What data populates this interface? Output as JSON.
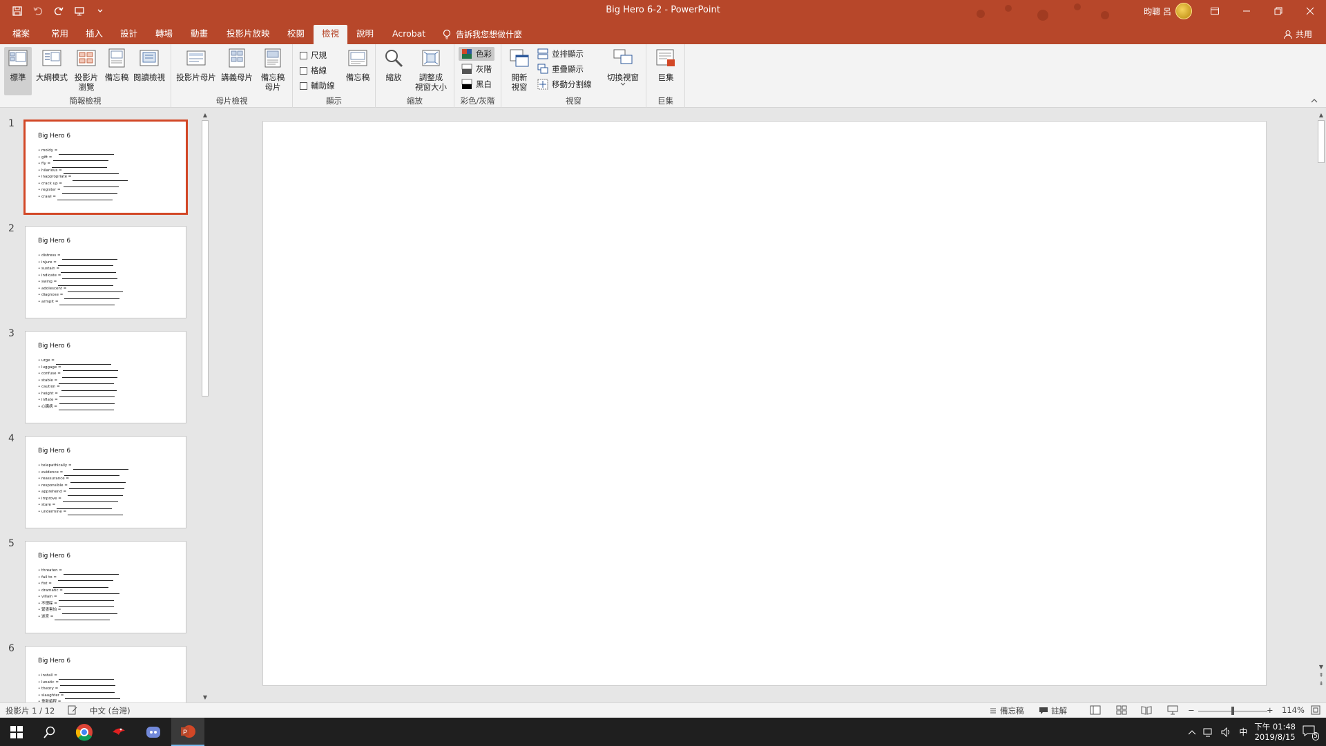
{
  "window": {
    "title": "Big Hero 6-2  -  PowerPoint",
    "user": "昀聰 呂"
  },
  "tabs": [
    "檔案",
    "常用",
    "插入",
    "設計",
    "轉場",
    "動畫",
    "投影片放映",
    "校閱",
    "檢視",
    "說明",
    "Acrobat"
  ],
  "active_tab": "檢視",
  "tell_me": "告訴我您想做什麼",
  "share": "共用",
  "ribbon": {
    "presentation_views": {
      "label": "簡報檢視",
      "normal": "標準",
      "outline": "大綱模式",
      "sorter_1": "投影片",
      "sorter_2": "瀏覽",
      "notes_page": "備忘稿",
      "reading": "閱讀檢視"
    },
    "master_views": {
      "label": "母片檢視",
      "slide_master": "投影片母片",
      "handout_master": "講義母片",
      "notes_master_1": "備忘稿",
      "notes_master_2": "母片"
    },
    "show": {
      "label": "顯示",
      "ruler": "尺規",
      "gridlines": "格線",
      "guides": "輔助線",
      "notes": "備忘稿"
    },
    "zoom": {
      "label": "縮放",
      "zoom": "縮放",
      "fit_1": "調整成",
      "fit_2": "視窗大小"
    },
    "color": {
      "label": "彩色/灰階",
      "color": "色彩",
      "grayscale": "灰階",
      "bw": "黑白"
    },
    "window": {
      "label": "視窗",
      "new_1": "開新",
      "new_2": "視窗",
      "arrange": "並排顯示",
      "cascade": "重疊顯示",
      "move_split": "移動分割線",
      "switch": "切換視窗"
    },
    "macros": {
      "label": "巨集",
      "macros": "巨集"
    }
  },
  "slides": [
    {
      "num": "1",
      "title": "Big Hero 6",
      "items": [
        "moldy =",
        "gift =",
        "fly =",
        "hilarious =",
        "inappropriate =",
        "crack up =",
        "register =",
        "crawl ="
      ]
    },
    {
      "num": "2",
      "title": "Big Hero 6",
      "items": [
        "distress =",
        "injure =",
        "sustain =",
        "indicate =",
        "swing =",
        "adolescent =",
        "diagnose =",
        "armpit ="
      ]
    },
    {
      "num": "3",
      "title": "Big Hero 6",
      "items": [
        "urge =",
        "luggage =",
        "confuse =",
        "stable =",
        "caution =",
        "height =",
        "inflate =",
        "心臟病 ="
      ]
    },
    {
      "num": "4",
      "title": "Big Hero 6",
      "items": [
        "telepathically =",
        "evidence =",
        "reassurance =",
        "responsible =",
        "apprehend =",
        "improve =",
        "stare =",
        "undermine ="
      ]
    },
    {
      "num": "5",
      "title": "Big Hero 6",
      "items": [
        "threaten =",
        "fail to =",
        "fist =",
        "dramatic =",
        "villain =",
        "不理睬 =",
        "緊張害怕 =",
        "迷宮 ="
      ]
    },
    {
      "num": "6",
      "title": "Big Hero 6",
      "items": [
        "install =",
        "lunatic =",
        "theory =",
        "slaughter =",
        "重新編程 ="
      ]
    }
  ],
  "status": {
    "slide_of": "投影片 1 / 12",
    "language": "中文 (台灣)",
    "notes": "備忘稿",
    "comments": "註解",
    "zoom": "114%"
  },
  "taskbar": {
    "time": "下午 01:48",
    "date": "2019/8/15",
    "ime": "中",
    "notif_count": "5"
  }
}
